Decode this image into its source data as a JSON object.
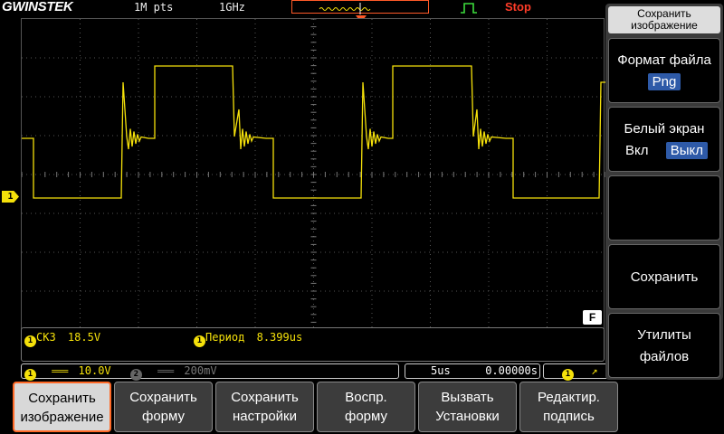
{
  "header": {
    "brand": "GWINSTEK",
    "memory_depth": "1M pts",
    "sample_rate": "1GHz",
    "run_state": "Stop"
  },
  "channel_marker": "1",
  "screen_badge": "F",
  "measurements": {
    "m1_channel": "1",
    "m1_label": "СКЗ",
    "m1_value": "18.5V",
    "m2_channel": "1",
    "m2_label": "Период",
    "m2_value": "8.399us"
  },
  "status": {
    "ch1_num": "1",
    "ch1_coupling": "═══",
    "ch1_scale": "10.0V",
    "ch2_num": "2",
    "ch2_coupling": "═══",
    "ch2_scale": "200mV",
    "timebase": "5us",
    "position": "0.00000s",
    "trig_channel": "1",
    "trig_slope": "↗"
  },
  "side_menu": {
    "title_line1": "Сохранить",
    "title_line2": "изображение",
    "format_label": "Формат файла",
    "format_value": "Png",
    "inkjet_label": "Белый экран",
    "inkjet_on": "Вкл",
    "inkjet_off": "Выкл",
    "save_label": "Сохранить",
    "utils_line1": "Утилиты",
    "utils_line2": "файлов"
  },
  "softkeys": [
    {
      "l1": "Сохранить",
      "l2": "изображение"
    },
    {
      "l1": "Сохранить",
      "l2": "форму"
    },
    {
      "l1": "Сохранить",
      "l2": "настройки"
    },
    {
      "l1": "Воспр.",
      "l2": "форму"
    },
    {
      "l1": "Вызвать",
      "l2": "Установки"
    },
    {
      "l1": "Редактир.",
      "l2": "подпись"
    }
  ],
  "colors": {
    "ch1": "#f5e10a",
    "ch2": "#888888",
    "trigger": "#ff5a28",
    "selected": "#2e5aa8"
  }
}
